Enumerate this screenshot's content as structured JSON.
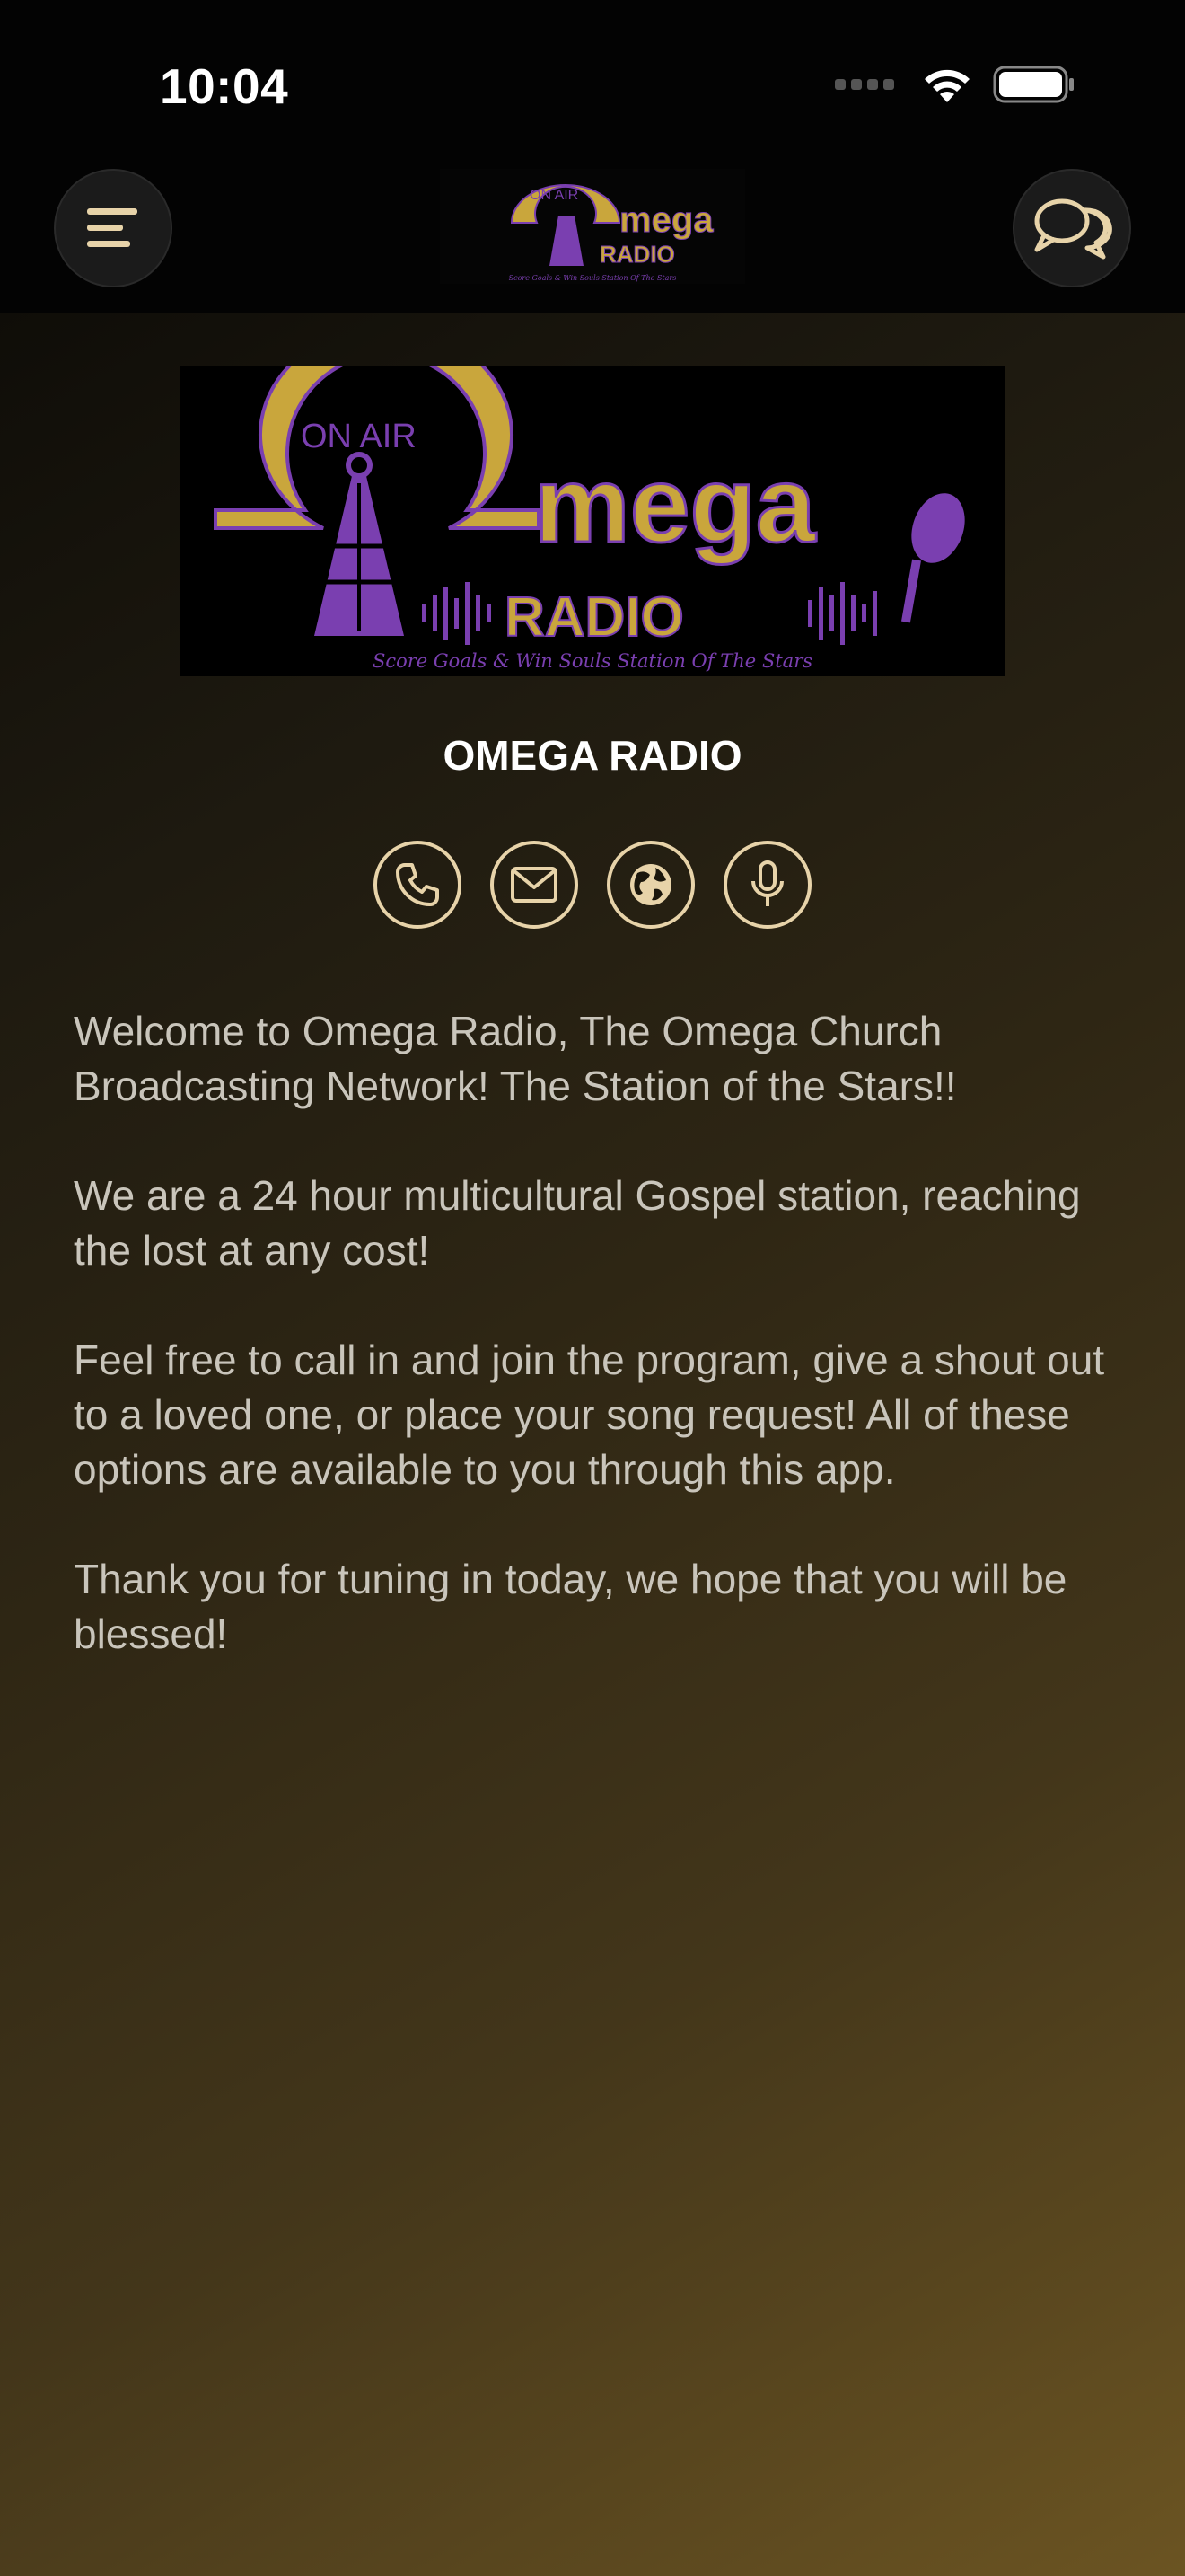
{
  "status_bar": {
    "time": "10:04"
  },
  "header": {
    "menu_icon": "menu-icon",
    "chat_icon": "chat-bubbles-icon",
    "logo": {
      "on_air": "ON AIR",
      "brand": "mega",
      "radio": "RADIO",
      "tagline": "Score Goals & Win Souls Station Of The Stars"
    }
  },
  "station": {
    "logo": {
      "on_air": "ON AIR",
      "brand": "mega",
      "radio": "RADIO",
      "tagline": "Score Goals & Win Souls Station Of The Stars"
    },
    "name": "OMEGA RADIO",
    "actions": [
      {
        "icon": "phone-icon"
      },
      {
        "icon": "mail-icon"
      },
      {
        "icon": "globe-icon"
      },
      {
        "icon": "microphone-icon"
      }
    ],
    "description": [
      "Welcome to Omega Radio, The Omega Church Broadcasting Network! The Station of the Stars!!",
      "We are a 24 hour multicultural Gospel station, reaching the lost at any cost!",
      "Feel free to call in and join the program, give a shout out to a loved one, or place your song request! All of these options are available to you through this app.",
      "Thank you for tuning in today, we hope that you will be blessed!"
    ]
  },
  "colors": {
    "accent": "#e7d3a9",
    "logo_gold": "#c9a63c",
    "logo_purple": "#7a3fb0",
    "text": "#c9c5bb"
  }
}
